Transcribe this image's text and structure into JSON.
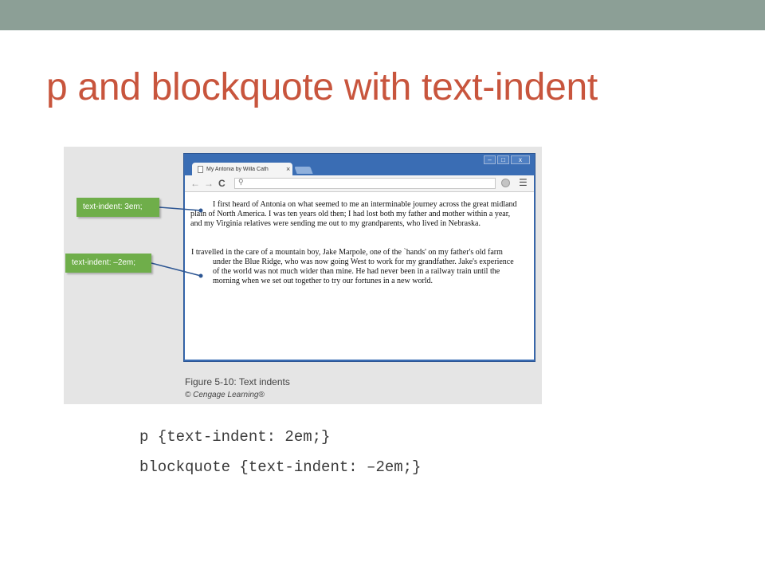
{
  "slide": {
    "title": "p and blockquote with text-indent",
    "accent_color": "#c8553d",
    "top_bar_color": "#8c9f96"
  },
  "figure": {
    "browser": {
      "tab_title": "My Antonia by Willa Cath",
      "tab_close": "×",
      "controls": {
        "minimize": "–",
        "maximize": "□",
        "close": "x"
      },
      "nav": {
        "back": "←",
        "forward": "→",
        "reload": "C"
      },
      "address_icon": "search-icon",
      "paragraph": "I first heard of Antonia on what seemed to me an interminable journey across the great midland plain of North America. I was ten years old then; I had lost both my father and mother within a year, and my Virginia relatives were sending me out to my grandparents, who lived in Nebraska.",
      "blockquote": "I travelled in the care of a mountain boy, Jake Marpole, one of the `hands' on my father's old farm under the Blue Ridge, who was now going West to work for my grandfather. Jake's experience of the world was not much wider than mine. He had never been in a railway train until the morning when we set out together to try our fortunes in a new world."
    },
    "callouts": {
      "paragraph": "text-indent: 3em;",
      "blockquote": "text-indent: –2em;"
    },
    "callout_color": "#6fae4a",
    "caption": "Figure 5-10: Text indents",
    "credit": "© Cengage Learning®"
  },
  "code": [
    "p {text-indent: 2em;}",
    "blockquote {text-indent: –2em;}"
  ]
}
